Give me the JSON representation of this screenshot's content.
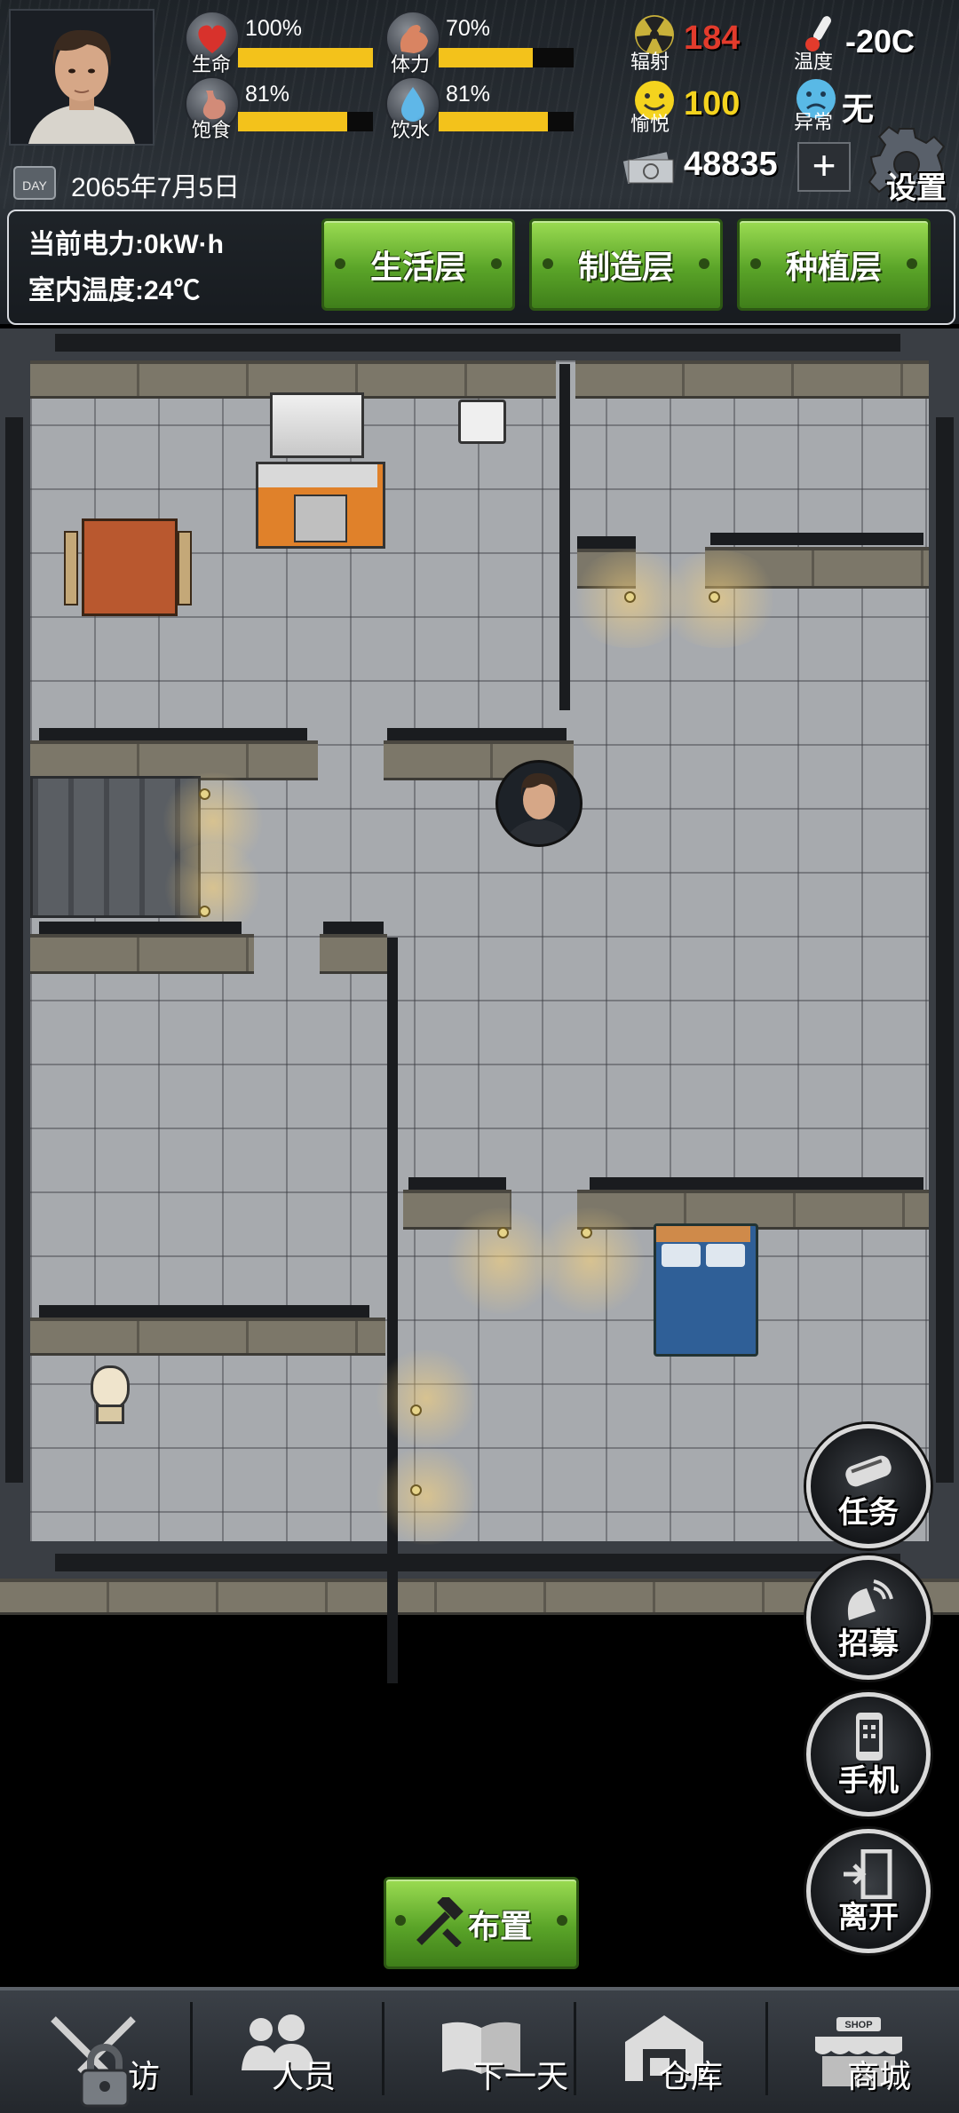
{
  "player": {
    "stats": [
      {
        "label": "生命",
        "percent_text": "100%",
        "level": 1.0,
        "icon": "heart-icon"
      },
      {
        "label": "体力",
        "percent_text": "70%",
        "level": 0.7,
        "icon": "muscle-icon"
      },
      {
        "label": "饱食",
        "percent_text": "81%",
        "level": 0.81,
        "icon": "stomach-icon"
      },
      {
        "label": "饮水",
        "percent_text": "81%",
        "level": 0.81,
        "icon": "water-drop-icon"
      }
    ]
  },
  "resources": {
    "radiation": {
      "label": "辐射",
      "value": "184",
      "color": "#e23b2c",
      "icon": "radiation-icon"
    },
    "temperature": {
      "label": "温度",
      "value": "-20C",
      "icon": "thermometer-icon"
    },
    "happiness": {
      "label": "愉悦",
      "value": "100",
      "color": "#f4d31e",
      "icon": "smiley-icon"
    },
    "abnormal": {
      "label": "异常",
      "value": "无",
      "icon": "sad-face-icon"
    },
    "money": {
      "value": "48835",
      "icon": "money-icon",
      "add_label": "+"
    }
  },
  "date": {
    "text": "2065年7月5日",
    "icon": "calendar-day-icon",
    "icon_text": "DAY"
  },
  "settings": {
    "label": "设置",
    "icon": "gear-icon"
  },
  "power": {
    "text": "当前电力:0kW·h"
  },
  "indoor_temp": {
    "text": "室内温度:24℃"
  },
  "layers": [
    {
      "label": "生活层"
    },
    {
      "label": "制造层"
    },
    {
      "label": "种植层"
    }
  ],
  "side_buttons": [
    {
      "label": "任务",
      "icon": "scroll-icon"
    },
    {
      "label": "招募",
      "icon": "satellite-dish-icon"
    },
    {
      "label": "手机",
      "icon": "phone-icon"
    },
    {
      "label": "离开",
      "icon": "exit-door-icon"
    }
  ],
  "layout_button": {
    "label": "布置",
    "icon": "hammer-wrench-icon"
  },
  "bottom_nav": [
    {
      "label": "访",
      "icon": "lock-icon",
      "locked": true
    },
    {
      "label": "人员",
      "icon": "people-icon"
    },
    {
      "label": "下一天",
      "icon": "book-icon"
    },
    {
      "label": "仓库",
      "icon": "warehouse-icon"
    },
    {
      "label": "商城",
      "icon": "shop-icon",
      "badge": "SHOP"
    }
  ],
  "colors": {
    "accent_green": "#5aa428",
    "bar_yellow": "#f3c21b",
    "radiation_red": "#e23b2c",
    "happiness_yellow": "#f4d31e"
  }
}
